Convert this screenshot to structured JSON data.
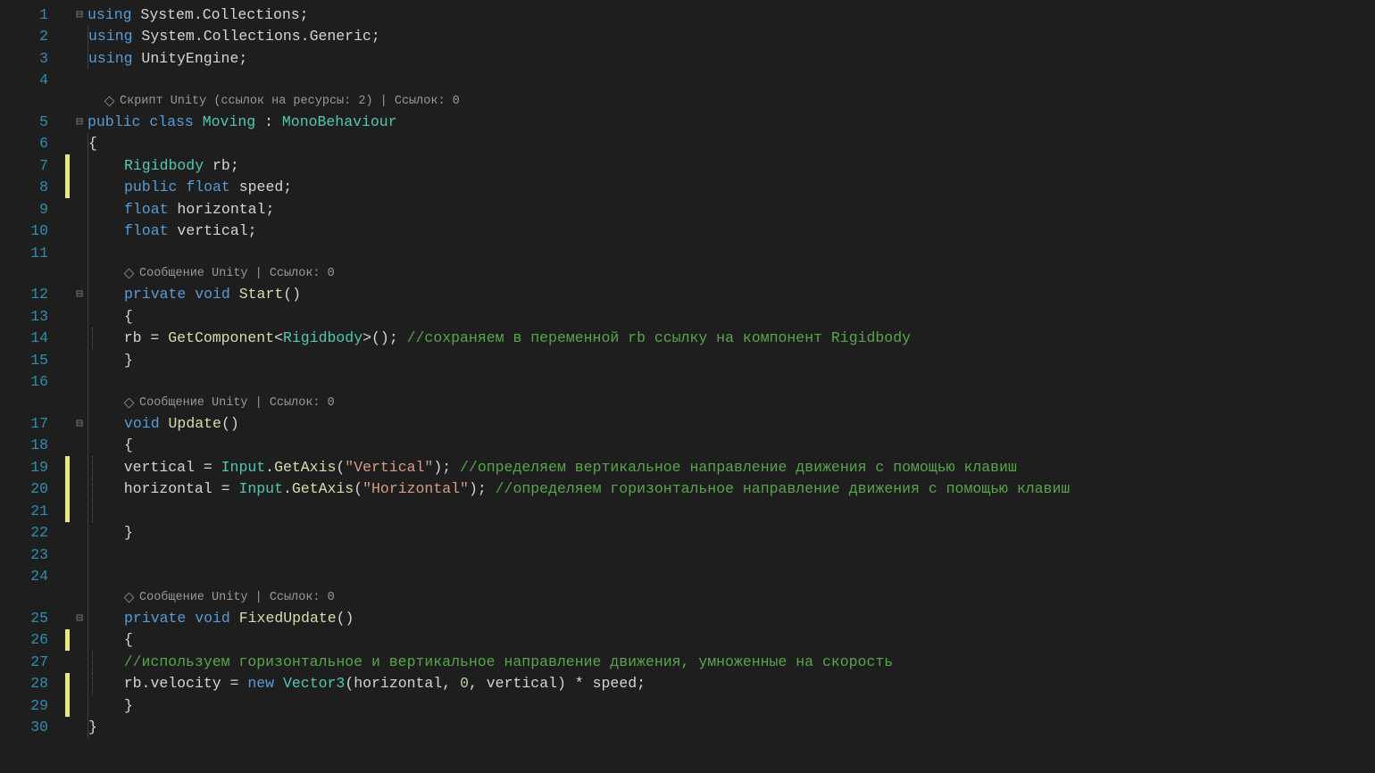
{
  "lines": {
    "l1": {
      "num": "1"
    },
    "l2": {
      "num": "2"
    },
    "l3": {
      "num": "3"
    },
    "l4": {
      "num": "4"
    },
    "l5": {
      "num": "5"
    },
    "l6": {
      "num": "6"
    },
    "l7": {
      "num": "7"
    },
    "l8": {
      "num": "8"
    },
    "l9": {
      "num": "9"
    },
    "l10": {
      "num": "10"
    },
    "l11": {
      "num": "11"
    },
    "l12": {
      "num": "12"
    },
    "l13": {
      "num": "13"
    },
    "l14": {
      "num": "14"
    },
    "l15": {
      "num": "15"
    },
    "l16": {
      "num": "16"
    },
    "l17": {
      "num": "17"
    },
    "l18": {
      "num": "18"
    },
    "l19": {
      "num": "19"
    },
    "l20": {
      "num": "20"
    },
    "l21": {
      "num": "21"
    },
    "l22": {
      "num": "22"
    },
    "l23": {
      "num": "23"
    },
    "l24": {
      "num": "24"
    },
    "l25": {
      "num": "25"
    },
    "l26": {
      "num": "26"
    },
    "l27": {
      "num": "27"
    },
    "l28": {
      "num": "28"
    },
    "l29": {
      "num": "29"
    },
    "l30": {
      "num": "30"
    }
  },
  "tokens": {
    "using": "using",
    "public": "public",
    "class": "class",
    "private": "private",
    "void": "void",
    "float": "float",
    "new": "new",
    "System": "System",
    "Collections": "Collections",
    "Generic": "Generic",
    "UnityEngine": "UnityEngine",
    "Moving": "Moving",
    "MonoBehaviour": "MonoBehaviour",
    "Rigidbody": "Rigidbody",
    "rb": "rb",
    "speed": "speed",
    "horizontal": "horizontal",
    "vertical": "vertical",
    "Start": "Start",
    "Update": "Update",
    "FixedUpdate": "FixedUpdate",
    "GetComponent": "GetComponent",
    "Input": "Input",
    "GetAxis": "GetAxis",
    "Vector3": "Vector3",
    "velocity": "velocity",
    "strVertical": "\"Vertical\"",
    "strHorizontal": "\"Horizontal\"",
    "zero": "0"
  },
  "comments": {
    "c14": "//сохраняем в переменной rb ссылку на компонент Rigidbody",
    "c19": "//определяем вертикальное направление движения с помощью клавиш",
    "c20": "//определяем горизонтальное направление движения с помощью клавиш",
    "c27": "//используем горизонтальное и вертикальное направление движения, умноженные на скорость"
  },
  "codelens": {
    "script": "Скрипт Unity (ссылок на ресурсы: 2) | Ссылок: 0",
    "message": "Сообщение Unity | Ссылок: 0"
  },
  "fold": {
    "minus": "⊟"
  }
}
